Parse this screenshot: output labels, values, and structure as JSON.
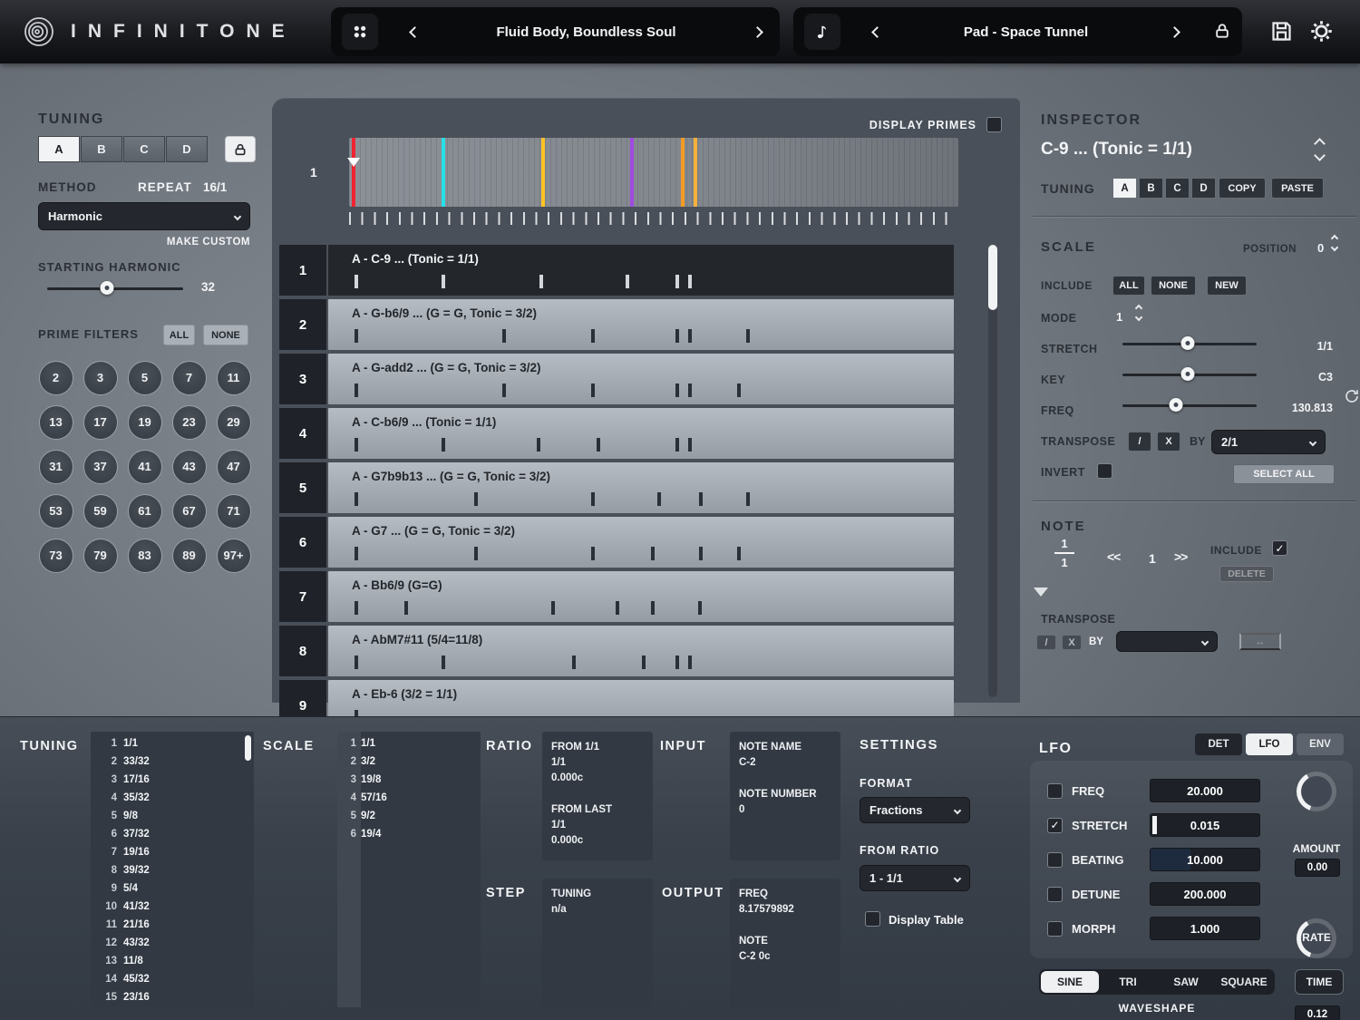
{
  "topbar": {
    "brand": "INFINITONE",
    "preset_patch": {
      "label": "Fluid Body, Boundless Soul"
    },
    "preset_sound": {
      "label": "Pad - Space Tunnel"
    }
  },
  "tuning_panel": {
    "title": "TUNING",
    "slots": [
      "A",
      "B",
      "C",
      "D"
    ],
    "selected_slot": "A",
    "method_label": "METHOD",
    "repeat_label": "REPEAT",
    "repeat_value": "16/1",
    "method_value": "Harmonic",
    "make_custom_label": "MAKE CUSTOM",
    "starting_harmonic_label": "STARTING HARMONIC",
    "starting_harmonic_value": "32",
    "prime_filters_label": "PRIME FILTERS",
    "all_label": "ALL",
    "none_label": "NONE",
    "primes": [
      "2",
      "3",
      "5",
      "7",
      "11",
      "13",
      "17",
      "19",
      "23",
      "29",
      "31",
      "37",
      "41",
      "43",
      "47",
      "53",
      "59",
      "61",
      "67",
      "71",
      "73",
      "79",
      "83",
      "89",
      "97+"
    ]
  },
  "sequencer": {
    "display_primes_label": "DISPLAY PRIMES",
    "ruler_row_number": "1",
    "ruler_markers": [
      {
        "pos": 0.5,
        "color": "#f32331",
        "handle": true
      },
      {
        "pos": 15.2,
        "color": "#27dfe8"
      },
      {
        "pos": 31.6,
        "color": "#ffc325"
      },
      {
        "pos": 46.1,
        "color": "#a04ae0"
      },
      {
        "pos": 54.5,
        "color": "#f59a23"
      },
      {
        "pos": 56.6,
        "color": "#f5b13c"
      }
    ],
    "rows": [
      {
        "num": "1",
        "title": "A - C-9 ... (Tonic = 1/1)",
        "selected": true,
        "ticks": [
          0.5,
          15.3,
          31.9,
          46.5,
          54.9,
          57.0
        ]
      },
      {
        "num": "2",
        "title": "A - G-b6/9 ... (G = G, Tonic = 3/2)",
        "selected": false,
        "ticks": [
          0.5,
          25.6,
          40.6,
          54.9,
          57.0,
          66.9
        ]
      },
      {
        "num": "3",
        "title": "A - G-add2 ... (G = G, Tonic = 3/2)",
        "selected": false,
        "ticks": [
          0.5,
          25.6,
          40.6,
          54.9,
          57.0,
          65.4
        ]
      },
      {
        "num": "4",
        "title": "A - C-b6/9 ... (Tonic = 1/1)",
        "selected": false,
        "ticks": [
          0.5,
          15.3,
          31.4,
          41.5,
          54.9,
          57.0
        ]
      },
      {
        "num": "5",
        "title": "A - G7b9b13 ... (G = G, Tonic = 3/2)",
        "selected": false,
        "ticks": [
          0.5,
          20.8,
          40.6,
          51.9,
          58.9,
          66.9
        ]
      },
      {
        "num": "6",
        "title": "A - G7 ... (G = G, Tonic = 3/2)",
        "selected": false,
        "ticks": [
          0.5,
          20.8,
          40.6,
          50.8,
          58.9,
          65.4
        ]
      },
      {
        "num": "7",
        "title": "A - Bb6/9 (G=G)",
        "selected": false,
        "ticks": [
          0.5,
          8.9,
          33.8,
          44.7,
          50.7,
          58.8
        ]
      },
      {
        "num": "8",
        "title": "A - AbM7#11 (5/4=11/8)",
        "selected": false,
        "ticks": [
          0.5,
          15.3,
          37.4,
          49.2,
          54.9,
          57.0
        ]
      },
      {
        "num": "9",
        "title": "A - Eb-6 (3/2 = 1/1)",
        "selected": false,
        "ticks": [
          0.5
        ]
      }
    ]
  },
  "inspector": {
    "title": "INSPECTOR",
    "selection_title": "C-9 ... (Tonic = 1/1)",
    "tuning_label": "TUNING",
    "tuning_slots": [
      "A",
      "B",
      "C",
      "D"
    ],
    "selected_tuning_slot": "A",
    "copy_label": "COPY",
    "paste_label": "PASTE",
    "scale": {
      "title": "SCALE",
      "position_label": "POSITION",
      "position_value": "0",
      "include_label": "INCLUDE",
      "all_label": "ALL",
      "none_label": "NONE",
      "new_label": "NEW",
      "mode_label": "MODE",
      "mode_value": "1",
      "stretch_label": "STRETCH",
      "stretch_value": "1/1",
      "key_label": "KEY",
      "key_value": "C3",
      "freq_label": "FREQ",
      "freq_value": "130.813",
      "transpose_label": "TRANSPOSE",
      "divide_label": "/",
      "multiply_label": "X",
      "by_label": "BY",
      "transpose_by_value": "2/1",
      "invert_label": "INVERT",
      "select_all_label": "SELECT ALL"
    },
    "note": {
      "title": "NOTE",
      "fraction_numerator": "1",
      "fraction_denominator": "1",
      "prev_label": "<<",
      "index_value": "1",
      "next_label": ">>",
      "include_label": "INCLUDE",
      "delete_label": "DELETE",
      "transpose_label": "TRANSPOSE",
      "divide_label": "/",
      "multiply_label": "X",
      "by_label": "BY"
    }
  },
  "bottom": {
    "tuning_list": {
      "label": "TUNING",
      "items": [
        {
          "n": "1",
          "v": "1/1"
        },
        {
          "n": "2",
          "v": "33/32"
        },
        {
          "n": "3",
          "v": "17/16"
        },
        {
          "n": "4",
          "v": "35/32"
        },
        {
          "n": "5",
          "v": "9/8"
        },
        {
          "n": "6",
          "v": "37/32"
        },
        {
          "n": "7",
          "v": "19/16"
        },
        {
          "n": "8",
          "v": "39/32"
        },
        {
          "n": "9",
          "v": "5/4"
        },
        {
          "n": "10",
          "v": "41/32"
        },
        {
          "n": "11",
          "v": "21/16"
        },
        {
          "n": "12",
          "v": "43/32"
        },
        {
          "n": "13",
          "v": "11/8"
        },
        {
          "n": "14",
          "v": "45/32"
        },
        {
          "n": "15",
          "v": "23/16"
        }
      ]
    },
    "scale_list": {
      "label": "SCALE",
      "items": [
        {
          "n": "1",
          "v": "1/1"
        },
        {
          "n": "2",
          "v": "3/2"
        },
        {
          "n": "3",
          "v": "19/8"
        },
        {
          "n": "4",
          "v": "57/16"
        },
        {
          "n": "5",
          "v": "9/2"
        },
        {
          "n": "6",
          "v": "19/4"
        }
      ]
    },
    "ratio": {
      "label": "RATIO",
      "lines": [
        "FROM 1/1",
        "1/1",
        "0.000c",
        "",
        "FROM LAST",
        "1/1",
        "0.000c"
      ]
    },
    "step": {
      "label": "STEP",
      "lines": [
        "TUNING",
        "n/a"
      ]
    },
    "input": {
      "label": "INPUT",
      "lines": [
        "NOTE NAME",
        "C-2",
        "",
        "NOTE NUMBER",
        "0"
      ]
    },
    "output": {
      "label": "OUTPUT",
      "lines": [
        "FREQ",
        "8.17579892",
        "",
        "NOTE",
        "C-2 0c"
      ]
    },
    "settings": {
      "title": "SETTINGS",
      "format_label": "FORMAT",
      "format_value": "Fractions",
      "from_ratio_label": "FROM RATIO",
      "from_ratio_value": "1 - 1/1",
      "display_table_label": "Display Table"
    },
    "lfo": {
      "title": "LFO",
      "tabs": [
        "DET",
        "LFO",
        "ENV"
      ],
      "selected_tab": "LFO",
      "params": [
        {
          "label": "FREQ",
          "value": "20.000",
          "checked": false
        },
        {
          "label": "STRETCH",
          "value": "0.015",
          "checked": true
        },
        {
          "label": "BEATING",
          "value": "10.000",
          "checked": false
        },
        {
          "label": "DETUNE",
          "value": "200.000",
          "checked": false
        },
        {
          "label": "MORPH",
          "value": "1.000",
          "checked": false
        }
      ],
      "amount_value": "0.00",
      "amount_label": "AMOUNT",
      "rate_value": "0.12",
      "rate_label": "RATE",
      "waveshapes": [
        "SINE",
        "TRI",
        "SAW",
        "SQUARE"
      ],
      "selected_waveshape": "SINE",
      "waveshape_label": "WAVESHAPE",
      "time_label": "TIME"
    }
  }
}
